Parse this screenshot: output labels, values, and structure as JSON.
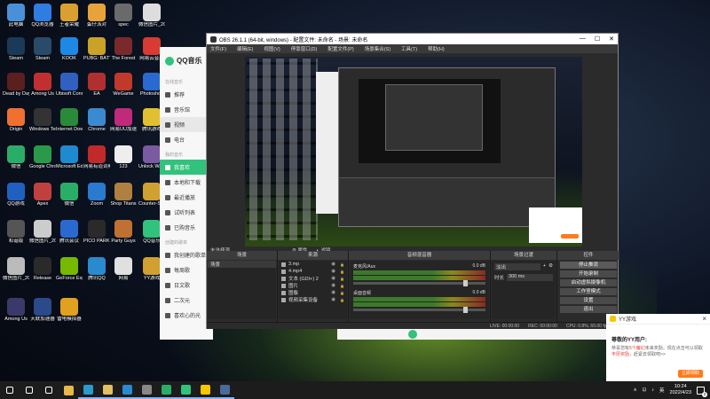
{
  "desktop_icons": [
    {
      "label": "此电脑",
      "color": "#4a90d9"
    },
    {
      "label": "QQ浏览器",
      "color": "#2f7de1"
    },
    {
      "label": "王者荣耀",
      "color": "#d9a030"
    },
    {
      "label": "蛋仔派对",
      "color": "#e8a23a"
    },
    {
      "label": "spec",
      "color": "#6a6a6a"
    },
    {
      "label": "微信图片_2022033...",
      "color": "#dddddd"
    },
    {
      "label": "Steam",
      "color": "#1b3a5a"
    },
    {
      "label": "Steam",
      "color": "#2a4a6a"
    },
    {
      "label": "KOOK",
      "color": "#1e88e5"
    },
    {
      "label": "PUBG: BATTLEGROUNDS",
      "color": "#c9a227"
    },
    {
      "label": "The Forest",
      "color": "#7a2a2a"
    },
    {
      "label": "网易云音乐",
      "color": "#d83a34"
    },
    {
      "label": "Dead by Daylight",
      "color": "#5a2020"
    },
    {
      "label": "Among Us",
      "color": "#c03030"
    },
    {
      "label": "Ubisoft Connect",
      "color": "#3060c0"
    },
    {
      "label": "EA",
      "color": "#b03030"
    },
    {
      "label": "WeGame",
      "color": "#c0392b"
    },
    {
      "label": "Photoshop",
      "color": "#2a6ad0"
    },
    {
      "label": "Origin",
      "color": "#f07030"
    },
    {
      "label": "Windows Terminal",
      "color": "#333333"
    },
    {
      "label": "Internet Download",
      "color": "#2a8a3a"
    },
    {
      "label": "Chrome",
      "color": "#3a8ad0"
    },
    {
      "label": "网易UU加速器",
      "color": "#c02a7a"
    },
    {
      "label": "腾讯游戏",
      "color": "#e0c030"
    },
    {
      "label": "微信",
      "color": "#2aae67"
    },
    {
      "label": "Google Chrome",
      "color": "#2a9a4a"
    },
    {
      "label": "Microsoft Edge",
      "color": "#1e8ad0"
    },
    {
      "label": "网易有道词典",
      "color": "#c02a2a"
    },
    {
      "label": "123",
      "color": "#eeeeee"
    },
    {
      "label": "Unlock Wallet",
      "color": "#7a5aa0"
    },
    {
      "label": "QQ游戏",
      "color": "#2060c0"
    },
    {
      "label": "Apex",
      "color": "#c04040"
    },
    {
      "label": "微信",
      "color": "#2aae67"
    },
    {
      "label": "Zoom",
      "color": "#2a7ad0"
    },
    {
      "label": "Shop Titans",
      "color": "#b08040"
    },
    {
      "label": "Counter-Strike: Global Off...",
      "color": "#d0a030"
    },
    {
      "label": "和谐版",
      "color": "#555555"
    },
    {
      "label": "微信图片_2020101...",
      "color": "#cccccc"
    },
    {
      "label": "腾讯会议",
      "color": "#2a6ad0"
    },
    {
      "label": "PICO PARK 2020",
      "color": "#2a2a2a"
    },
    {
      "label": "Party Guys",
      "color": "#c07030"
    },
    {
      "label": "QQ音乐",
      "color": "#31c27c"
    },
    {
      "label": "微信图片_2018101...",
      "color": "#bbbbbb"
    },
    {
      "label": "Release",
      "color": "#2a2a2a"
    },
    {
      "label": "GeForce Experience",
      "color": "#76b900"
    },
    {
      "label": "腾讯QQ",
      "color": "#2a8ad0"
    },
    {
      "label": "网易",
      "color": "#e0e0e0"
    },
    {
      "label": "YY游戏",
      "color": "#d0a030"
    },
    {
      "label": "Among Us",
      "color": "#3a3a6a"
    },
    {
      "label": "天联加速器",
      "color": "#2a4a8a"
    },
    {
      "label": "雷电模拟器",
      "color": "#e0a020"
    }
  ],
  "qq_music": {
    "app_name": "QQ音乐",
    "section_online": "在线音乐",
    "online_items": [
      "推荐",
      "音乐馆",
      "视频",
      "电台"
    ],
    "section_my": "我的音乐",
    "my_items": [
      "我喜欢",
      "本地和下载",
      "最近播放",
      "试听列表",
      "已购音乐"
    ],
    "section_created": "创建的歌单",
    "created_items": [
      "我创建的歌单",
      "每周歌",
      "日文歌",
      "二次元",
      "喜欢心的光"
    ]
  },
  "obs": {
    "title": "OBS 26.1.1 (64-bit, windows) - 配置文件: 未命名 - 场景: 未命名",
    "menu": [
      "文件(F)",
      "编辑(E)",
      "视图(V)",
      "停靠窗口(D)",
      "配置文件(P)",
      "场景集合(S)",
      "工具(T)",
      "帮助(H)"
    ],
    "no_source": "未选择源",
    "props_label": "属性",
    "filters_label": "滤镜",
    "docks": {
      "scenes": "场景",
      "sources": "来源",
      "mixer": "音频混音器",
      "transitions": "场景过渡",
      "controls": "控件"
    },
    "scene_item": "场景",
    "sources_list": [
      "3.mp",
      "4.mp4",
      "文本 (GDI+) 2",
      "图片",
      "图像",
      "视频采集设备"
    ],
    "mixer_channels": [
      {
        "name": "麦克风/Aux",
        "db": "0.0 dB"
      },
      {
        "name": "桌面音频",
        "db": "0.0 dB"
      }
    ],
    "transition_type": "淡出",
    "duration_label": "时长",
    "duration_value": "300 ms",
    "controls": [
      "停止推流",
      "开始录制",
      "启动虚拟摄像机",
      "工作室模式",
      "设置",
      "退出"
    ],
    "status": [
      "LIVE: 00:00:00",
      "REC: 00:00:00",
      "CPU: 0.8%, 60.00 fps"
    ]
  },
  "yy_popup": {
    "title": "YY游戏",
    "greeting": "尊敬的YY用户:",
    "message_pre": "恭喜您有",
    "message_highlight": "5个魔幻",
    "message_post": "未来奖励，现在点击可以领取",
    "message_highlight2": "丰厚奖励",
    "message_end": "，赶紧去领取吧>>",
    "button": "立即领取",
    "close": "×"
  },
  "taskbar": {
    "apps": [
      {
        "name": "start-icon",
        "color": "#ffffff"
      },
      {
        "name": "search-icon",
        "color": "#ffffff"
      },
      {
        "name": "task-view-icon",
        "color": "#ffffff"
      },
      {
        "name": "file-explorer-icon",
        "color": "#e8b84a"
      },
      {
        "name": "edge-icon",
        "color": "#2a9ad0"
      },
      {
        "name": "folder-icon",
        "color": "#e0c060"
      },
      {
        "name": "qq-icon",
        "color": "#2a8ad0"
      },
      {
        "name": "obs-icon",
        "color": "#888888"
      },
      {
        "name": "wechat-icon",
        "color": "#2aae67"
      },
      {
        "name": "qq-music-icon",
        "color": "#31c27c"
      },
      {
        "name": "yy-icon",
        "color": "#f7c600"
      },
      {
        "name": "steam-icon",
        "color": "#4a6a9a"
      }
    ],
    "time": "10:24",
    "date": "2022/4/23",
    "notif_count": "2"
  }
}
